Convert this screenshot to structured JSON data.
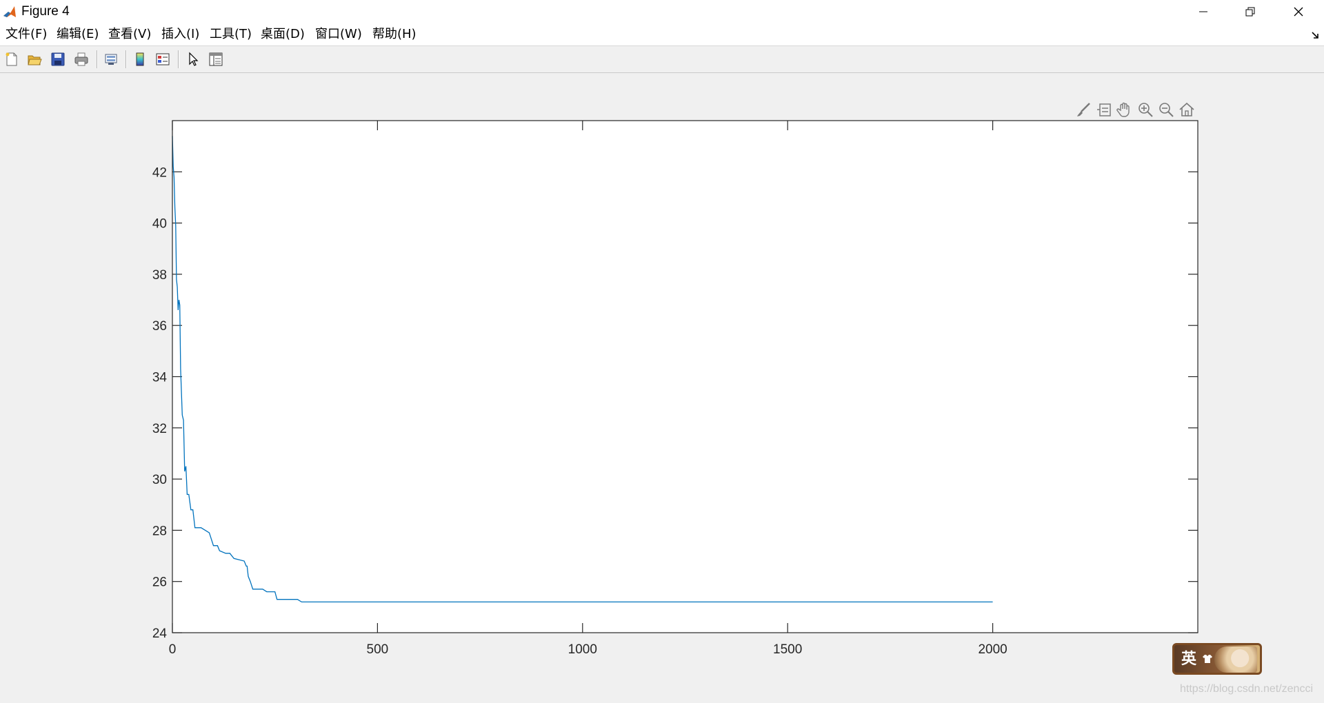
{
  "window": {
    "title": "Figure 4"
  },
  "menu": [
    "文件(F)",
    "编辑(E)",
    "查看(V)",
    "插入(I)",
    "工具(T)",
    "桌面(D)",
    "窗口(W)",
    "帮助(H)"
  ],
  "toolbar": {
    "buttons": [
      "new-figure-icon",
      "open-file-icon",
      "save-icon",
      "print-icon",
      "link-plot-icon",
      "colorbar-icon",
      "legend-icon",
      "edit-plot-icon",
      "property-inspector-icon"
    ]
  },
  "axes_toolbar": [
    "brush-icon",
    "data-tip-icon",
    "pan-icon",
    "zoom-in-icon",
    "zoom-out-icon",
    "home-icon"
  ],
  "ime": {
    "label": "英"
  },
  "watermark": "https://blog.csdn.net/zencci",
  "colors": {
    "line": "#0072bd",
    "axes_bg": "#ffffff",
    "figure_bg": "#f0f0f0"
  },
  "chart_data": {
    "type": "line",
    "xlim": [
      0,
      2500
    ],
    "ylim": [
      24,
      44
    ],
    "xticks": [
      0,
      500,
      1000,
      1500,
      2000
    ],
    "yticks": [
      24,
      26,
      28,
      30,
      32,
      34,
      36,
      38,
      40,
      42
    ],
    "grid": false,
    "box": true,
    "series": [
      {
        "color": "#0072bd",
        "points": [
          [
            0,
            43.4
          ],
          [
            2,
            42.2
          ],
          [
            4,
            41.8
          ],
          [
            6,
            40.6
          ],
          [
            8,
            39.9
          ],
          [
            10,
            37.8
          ],
          [
            12,
            37.5
          ],
          [
            14,
            36.6
          ],
          [
            16,
            37.0
          ],
          [
            18,
            36.8
          ],
          [
            20,
            34.3
          ],
          [
            24,
            32.5
          ],
          [
            27,
            32.3
          ],
          [
            30,
            30.3
          ],
          [
            33,
            30.5
          ],
          [
            36,
            29.4
          ],
          [
            40,
            29.4
          ],
          [
            45,
            28.8
          ],
          [
            50,
            28.8
          ],
          [
            55,
            28.1
          ],
          [
            70,
            28.1
          ],
          [
            90,
            27.9
          ],
          [
            100,
            27.4
          ],
          [
            110,
            27.4
          ],
          [
            115,
            27.2
          ],
          [
            130,
            27.1
          ],
          [
            140,
            27.1
          ],
          [
            150,
            26.9
          ],
          [
            175,
            26.8
          ],
          [
            180,
            26.6
          ],
          [
            182,
            26.6
          ],
          [
            185,
            26.2
          ],
          [
            190,
            26.0
          ],
          [
            196,
            25.7
          ],
          [
            220,
            25.7
          ],
          [
            230,
            25.6
          ],
          [
            250,
            25.6
          ],
          [
            255,
            25.3
          ],
          [
            305,
            25.3
          ],
          [
            315,
            25.2
          ],
          [
            2000,
            25.2
          ]
        ]
      }
    ]
  }
}
